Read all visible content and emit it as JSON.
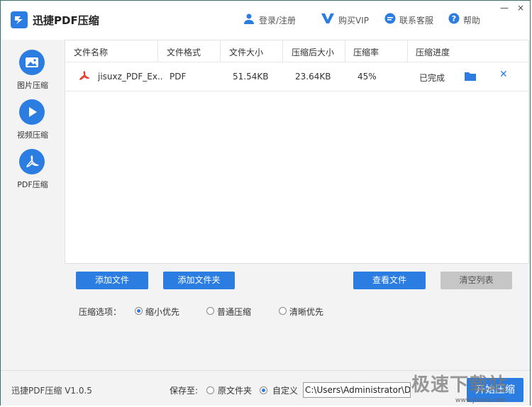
{
  "titlebar": {
    "app_title": "迅捷PDF压缩",
    "login": "登录/注册",
    "buy_vip": "购买VIP",
    "support": "联系客服",
    "help": "帮助",
    "minimize": "—",
    "close": "×"
  },
  "sidebar": {
    "items": [
      {
        "label": "图片压缩",
        "icon": "image-icon"
      },
      {
        "label": "视频压缩",
        "icon": "play-icon"
      },
      {
        "label": "PDF压缩",
        "icon": "pdf-icon"
      }
    ]
  },
  "table": {
    "headers": [
      "文件名称",
      "文件格式",
      "文件大小",
      "压缩后大小",
      "压缩率",
      "压缩进度"
    ],
    "rows": [
      {
        "name": "jisuxz_PDF_Ex..",
        "format": "PDF",
        "size": "51.54KB",
        "compressed_size": "23.64KB",
        "ratio": "45%",
        "progress": "已完成"
      }
    ]
  },
  "buttons": {
    "add_file": "添加文件",
    "add_folder": "添加文件夹",
    "view_file": "查看文件",
    "clear_list": "清空列表"
  },
  "options": {
    "label": "压缩选项：",
    "choices": [
      "缩小优先",
      "普通压缩",
      "清晰优先"
    ],
    "selected": "缩小优先"
  },
  "footer": {
    "version": "迅捷PDF压缩 V1.0.5",
    "save_to": "保存至:",
    "save_opts": [
      "原文件夹",
      "自定义"
    ],
    "save_selected": "自定义",
    "path": "C:\\Users\\Administrator\\D",
    "start": "开始压缩"
  },
  "watermark": {
    "text": "极速下载站",
    "url": "www.jisuxz.com"
  },
  "colors": {
    "accent": "#2b7de1",
    "disabled": "#c6c6c6"
  }
}
